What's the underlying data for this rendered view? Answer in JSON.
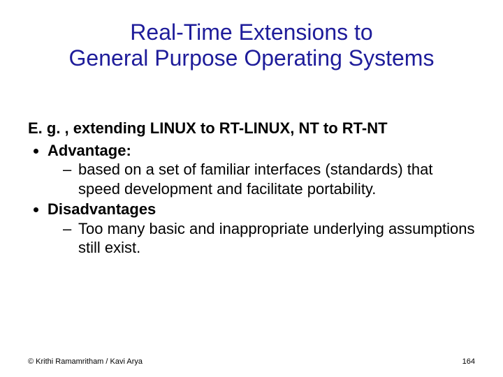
{
  "title_line1": "Real-Time Extensions to",
  "title_line2": "General Purpose Operating Systems",
  "eg_line": "E. g. , extending LINUX to RT-LINUX, NT to RT-NT",
  "bullets": {
    "advantage_label": "Advantage:",
    "advantage_item": " based on a set of familiar interfaces (standards) that speed development and facilitate portability.",
    "disadvantage_label": "Disadvantages",
    "disadvantage_item": "Too many basic and inappropriate underlying assumptions still exist."
  },
  "footer_left": "© Krithi Ramamritham / Kavi Arya",
  "footer_right": "164"
}
